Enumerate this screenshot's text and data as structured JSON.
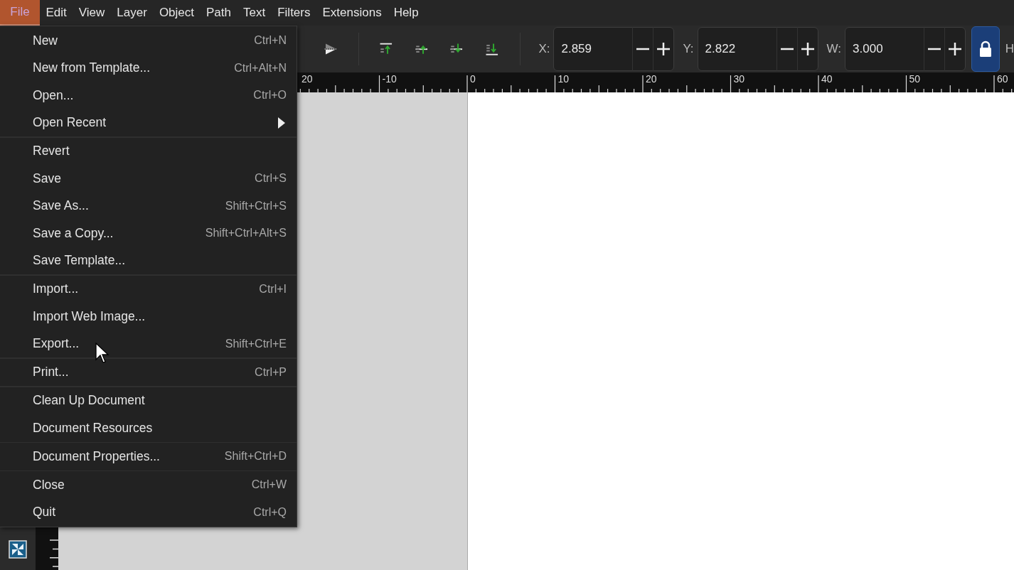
{
  "menubar": [
    {
      "label": "File",
      "selected": true
    },
    {
      "label": "Edit",
      "selected": false
    },
    {
      "label": "View",
      "selected": false
    },
    {
      "label": "Layer",
      "selected": false
    },
    {
      "label": "Object",
      "selected": false
    },
    {
      "label": "Path",
      "selected": false
    },
    {
      "label": "Text",
      "selected": false
    },
    {
      "label": "Filters",
      "selected": false
    },
    {
      "label": "Extensions",
      "selected": false
    },
    {
      "label": "Help",
      "selected": false
    }
  ],
  "toolbar": {
    "fields": [
      {
        "label": "X:",
        "value": "2.859"
      },
      {
        "label": "Y:",
        "value": "2.822"
      },
      {
        "label": "W:",
        "value": "3.000"
      }
    ],
    "lock": {
      "on": true
    },
    "next_label": "H"
  },
  "ruler": {
    "labels": [
      "20",
      "-10",
      "0",
      "10",
      "20",
      "30",
      "40",
      "50",
      "60"
    ]
  },
  "file_menu": {
    "groups": [
      [
        {
          "label": "New",
          "shortcut": "Ctrl+N",
          "submenu": false
        },
        {
          "label": "New from Template...",
          "shortcut": "Ctrl+Alt+N",
          "submenu": false
        },
        {
          "label": "Open...",
          "shortcut": "Ctrl+O",
          "submenu": false
        },
        {
          "label": "Open Recent",
          "submenu": true
        }
      ],
      [
        {
          "label": "Revert",
          "submenu": false
        },
        {
          "label": "Save",
          "shortcut": "Ctrl+S",
          "submenu": false
        },
        {
          "label": "Save As...",
          "shortcut": "Shift+Ctrl+S",
          "submenu": false
        },
        {
          "label": "Save a Copy...",
          "shortcut": "Shift+Ctrl+Alt+S",
          "submenu": false
        },
        {
          "label": "Save Template...",
          "submenu": false
        }
      ],
      [
        {
          "label": "Import...",
          "shortcut": "Ctrl+I",
          "submenu": false
        },
        {
          "label": "Import Web Image...",
          "submenu": false
        },
        {
          "label": "Export...",
          "shortcut": "Shift+Ctrl+E",
          "submenu": false
        }
      ],
      [
        {
          "label": "Print...",
          "shortcut": "Ctrl+P",
          "submenu": false
        }
      ],
      [
        {
          "label": "Clean Up Document",
          "submenu": false
        },
        {
          "label": "Document Resources",
          "submenu": false
        }
      ],
      [
        {
          "label": "Document Properties...",
          "shortcut": "Shift+Ctrl+D",
          "submenu": false
        }
      ],
      [
        {
          "label": "Close",
          "shortcut": "Ctrl+W",
          "submenu": false
        },
        {
          "label": "Quit",
          "shortcut": "Ctrl+Q",
          "submenu": false
        }
      ]
    ]
  }
}
